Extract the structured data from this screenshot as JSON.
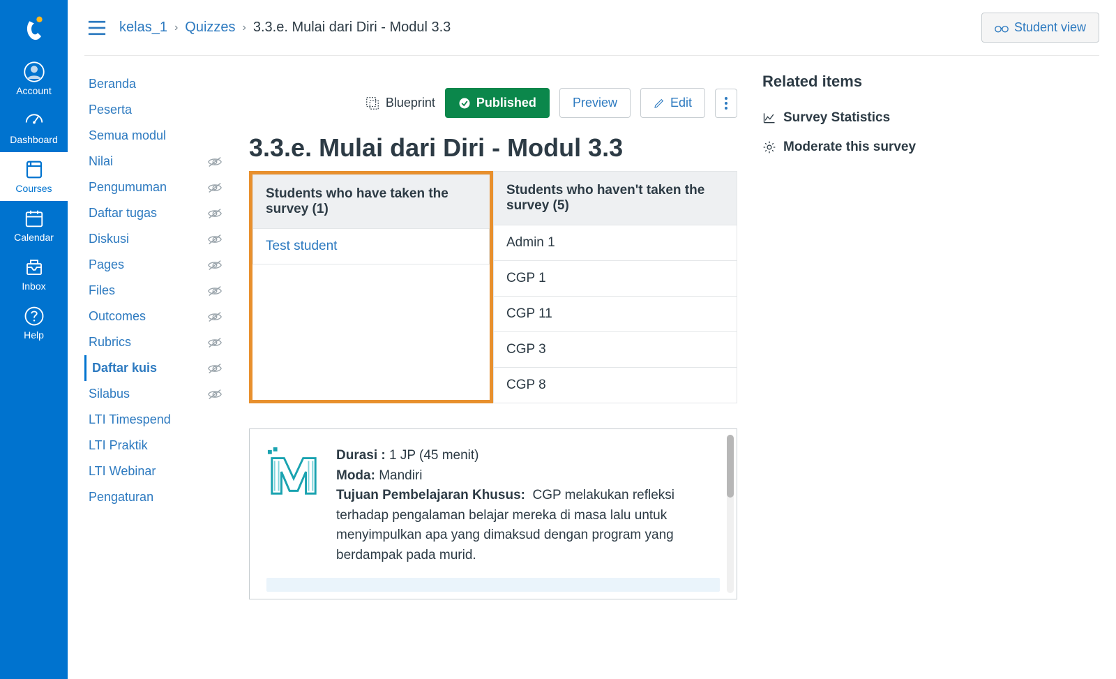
{
  "globalNav": {
    "items": [
      {
        "label": "Account",
        "icon": "account-icon"
      },
      {
        "label": "Dashboard",
        "icon": "dashboard-icon"
      },
      {
        "label": "Courses",
        "icon": "courses-icon"
      },
      {
        "label": "Calendar",
        "icon": "calendar-icon"
      },
      {
        "label": "Inbox",
        "icon": "inbox-icon"
      },
      {
        "label": "Help",
        "icon": "help-icon"
      }
    ]
  },
  "breadcrumbs": {
    "course": "kelas_1",
    "section": "Quizzes",
    "page": "3.3.e. Mulai dari Diri - Modul 3.3"
  },
  "studentView": "Student view",
  "courseNav": [
    {
      "label": "Beranda",
      "hidden": false
    },
    {
      "label": "Peserta",
      "hidden": false
    },
    {
      "label": "Semua modul",
      "hidden": false
    },
    {
      "label": "Nilai",
      "hidden": true
    },
    {
      "label": "Pengumuman",
      "hidden": true
    },
    {
      "label": "Daftar tugas",
      "hidden": true
    },
    {
      "label": "Diskusi",
      "hidden": true
    },
    {
      "label": "Pages",
      "hidden": true
    },
    {
      "label": "Files",
      "hidden": true
    },
    {
      "label": "Outcomes",
      "hidden": true
    },
    {
      "label": "Rubrics",
      "hidden": true
    },
    {
      "label": "Daftar kuis",
      "hidden": true,
      "active": true
    },
    {
      "label": "Silabus",
      "hidden": true
    },
    {
      "label": "LTI Timespend",
      "hidden": false
    },
    {
      "label": "LTI Praktik",
      "hidden": false
    },
    {
      "label": "LTI Webinar",
      "hidden": false
    },
    {
      "label": "Pengaturan",
      "hidden": false
    }
  ],
  "toolbar": {
    "blueprint": "Blueprint",
    "published": "Published",
    "preview": "Preview",
    "edit": "Edit"
  },
  "title": "3.3.e. Mulai dari Diri - Modul 3.3",
  "survey": {
    "taken": {
      "header": "Students who have taken the survey (1)",
      "students": [
        "Test student"
      ]
    },
    "notTaken": {
      "header": "Students who haven't taken the survey (5)",
      "students": [
        "Admin 1",
        "CGP 1",
        "CGP 11",
        "CGP 3",
        "CGP 8"
      ]
    }
  },
  "content": {
    "durasi_label": "Durasi :",
    "durasi_value": "1 JP (45 menit)",
    "moda_label": "Moda:",
    "moda_value": "Mandiri",
    "tujuan_label": "Tujuan Pembelajaran Khusus:",
    "tujuan_value": "CGP melakukan refleksi terhadap pengalaman belajar mereka di masa lalu untuk  menyimpulkan apa yang dimaksud dengan  program yang berdampak pada murid."
  },
  "rail": {
    "heading": "Related items",
    "stats": "Survey Statistics",
    "moderate": "Moderate this survey"
  }
}
